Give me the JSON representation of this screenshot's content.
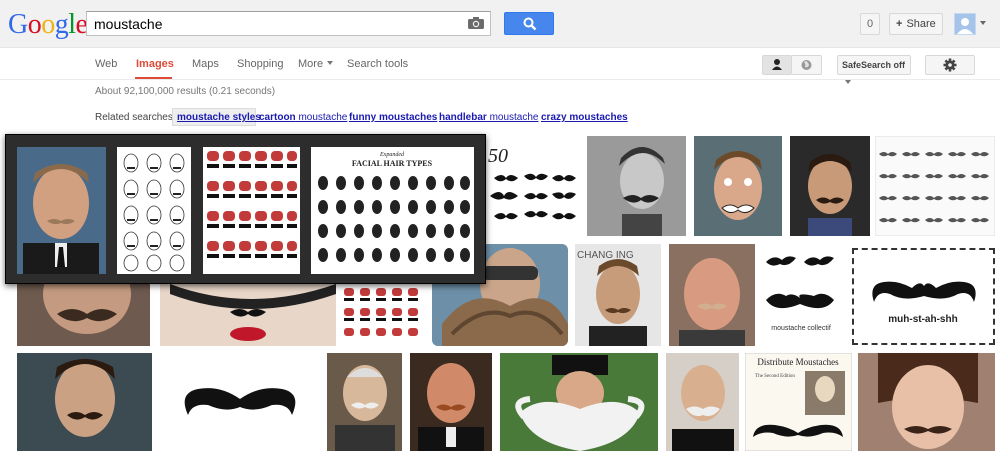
{
  "header": {
    "logo_letters": [
      "G",
      "o",
      "o",
      "g",
      "l",
      "e"
    ],
    "logo_colors": [
      "#3369e8",
      "#d50f25",
      "#eeb211",
      "#3369e8",
      "#009925",
      "#d50f25"
    ],
    "search_value": "moustache",
    "notifications_count": "0",
    "share_label": "Share"
  },
  "nav": {
    "items": [
      "Web",
      "Images",
      "Maps",
      "Shopping",
      "More",
      "Search tools"
    ],
    "active": "Images",
    "safesearch_label": "SafeSearch off"
  },
  "results": {
    "stats": "About 92,100,000 results (0.21 seconds)",
    "related_label": "Related searches:",
    "related": [
      {
        "bold": "moustache styles",
        "rest": ""
      },
      {
        "bold": "cartoon",
        "rest": " moustache"
      },
      {
        "bold": "funny moustaches",
        "rest": ""
      },
      {
        "bold": "handlebar",
        "rest": " moustache"
      },
      {
        "bold": "crazy moustaches",
        "rest": ""
      }
    ]
  },
  "popup": {
    "chart_title_top": "Expanded",
    "chart_title": "FACIAL HAIR TYPES"
  },
  "tiles": {
    "mustache_text_banner": "50",
    "muhstahshh": "muh-st-ah-shh",
    "moustache_collectif": "moustache collectif",
    "distribute_title": "Distribute Moustaches",
    "distribute_sub": "The Second Edition"
  },
  "colors": {
    "accent_red": "#dd4b39",
    "search_blue": "#4787ed",
    "link_blue": "#1a1ab0"
  }
}
